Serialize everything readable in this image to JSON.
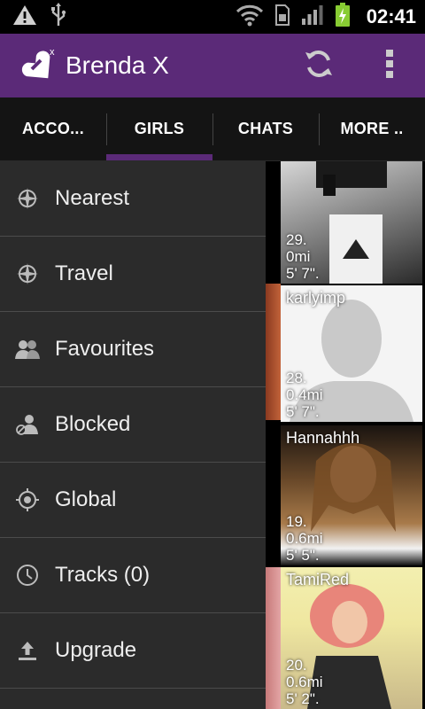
{
  "status_bar": {
    "time": "02:41",
    "icons": [
      "warning-icon",
      "usb-icon",
      "wifi-icon",
      "sim-icon",
      "signal-icon",
      "battery-charging-icon"
    ]
  },
  "action_bar": {
    "title": "Brenda X",
    "background": "#5b2a78",
    "actions": [
      "refresh-icon",
      "overflow-menu-icon"
    ]
  },
  "tabs": [
    {
      "label": "ACCO..."
    },
    {
      "label": "GIRLS",
      "active": true
    },
    {
      "label": "CHATS"
    },
    {
      "label": "MORE .."
    }
  ],
  "drawer": {
    "items": [
      {
        "label": "Nearest",
        "icon": "compass-icon"
      },
      {
        "label": "Travel",
        "icon": "compass-icon"
      },
      {
        "label": "Favourites",
        "icon": "people-icon"
      },
      {
        "label": "Blocked",
        "icon": "blocked-user-icon"
      },
      {
        "label": "Global",
        "icon": "target-icon"
      },
      {
        "label": "Tracks (0)",
        "icon": "clock-icon"
      },
      {
        "label": "Upgrade",
        "icon": "upload-icon"
      }
    ]
  },
  "profiles": [
    {
      "name": "",
      "age": "29.",
      "distance": "0mi",
      "height": "5' 7\"."
    },
    {
      "name": "karlyimp",
      "age": "28.",
      "distance": "0.4mi",
      "height": "5' 7\"."
    },
    {
      "name": "Hannahhh",
      "age": "19.",
      "distance": "0.6mi",
      "height": "5' 5\"."
    },
    {
      "name": "TamiRed",
      "age": "20.",
      "distance": "0.6mi",
      "height": "5' 2\"."
    }
  ]
}
